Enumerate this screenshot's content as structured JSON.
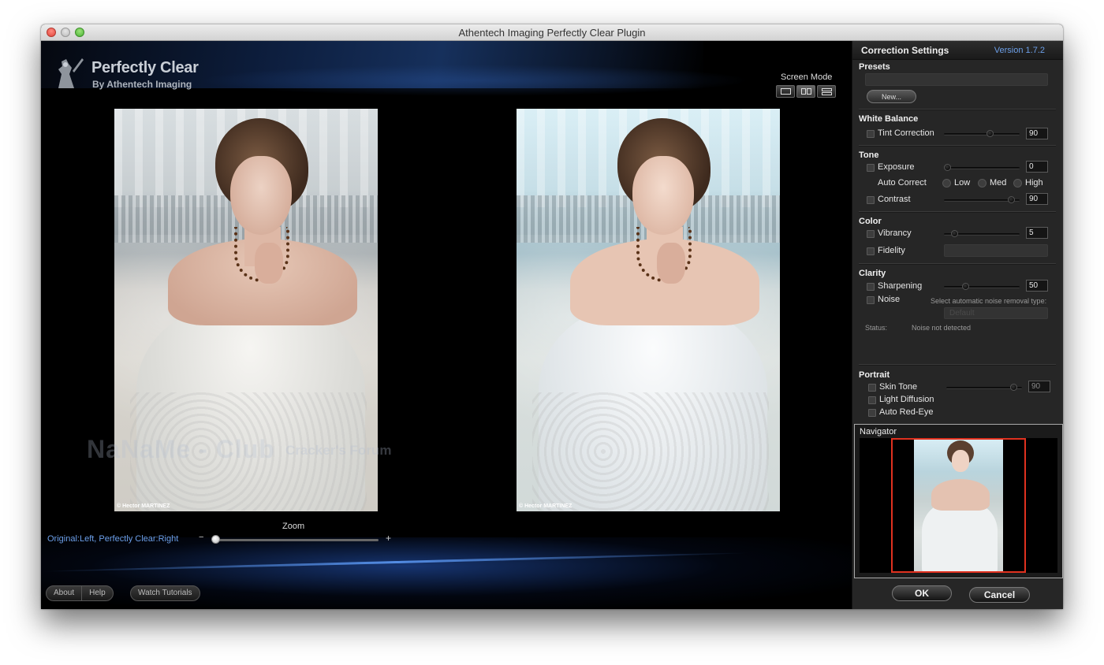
{
  "window": {
    "title": "Athentech Imaging Perfectly Clear Plugin"
  },
  "logo": {
    "title": "Perfectly Clear",
    "subtitle": "By Athentech Imaging"
  },
  "screen_mode": {
    "label": "Screen Mode",
    "active": "split"
  },
  "photos": {
    "left_credit": "© Hector MARTINEZ",
    "right_credit": "© Hector MARTINEZ"
  },
  "watermark": {
    "main": "NaNaMe - Club",
    "sub": "Cracker's Forum"
  },
  "zoom": {
    "label": "Zoom",
    "minus": "−",
    "plus": "+",
    "value": 0
  },
  "compare_label": "Original:Left, Perfectly Clear:Right",
  "footer": {
    "about": "About",
    "help": "Help",
    "tutorials": "Watch Tutorials"
  },
  "panel": {
    "title": "Correction Settings",
    "version": "Version 1.7.2",
    "presets": {
      "title": "Presets",
      "selected": "",
      "new_button": "New..."
    },
    "white_balance": {
      "title": "White Balance",
      "tint": {
        "label": "Tint Correction",
        "value": "90",
        "level": 0.6
      }
    },
    "tone": {
      "title": "Tone",
      "exposure": {
        "label": "Exposure",
        "value": "0",
        "level": 0.0
      },
      "auto_correct": {
        "label": "Auto Correct",
        "low": "Low",
        "med": "Med",
        "high": "High"
      },
      "contrast": {
        "label": "Contrast",
        "value": "90",
        "level": 0.9
      }
    },
    "color": {
      "title": "Color",
      "vibrancy": {
        "label": "Vibrancy",
        "value": "5",
        "level": 0.1
      },
      "fidelity": {
        "label": "Fidelity"
      }
    },
    "clarity": {
      "title": "Clarity",
      "sharpening": {
        "label": "Sharpening",
        "value": "50",
        "level": 0.25
      },
      "noise": {
        "label": "Noise",
        "hint": "Select automatic noise removal type:",
        "dropdown": "Default"
      },
      "status_label": "Status:",
      "status_value": "Noise not detected"
    },
    "portrait": {
      "title": "Portrait",
      "skin_tone": {
        "label": "Skin Tone",
        "value": "90",
        "level": 0.9
      },
      "light_diffusion": {
        "label": "Light Diffusion"
      },
      "auto_red_eye": {
        "label": "Auto Red-Eye"
      }
    },
    "navigator": {
      "title": "Navigator"
    },
    "ok": "OK",
    "cancel": "Cancel"
  },
  "colors": {
    "accent_blue": "#6c9fe8",
    "navigator_frame": "#e0311f",
    "panel_bg": "#262626"
  }
}
